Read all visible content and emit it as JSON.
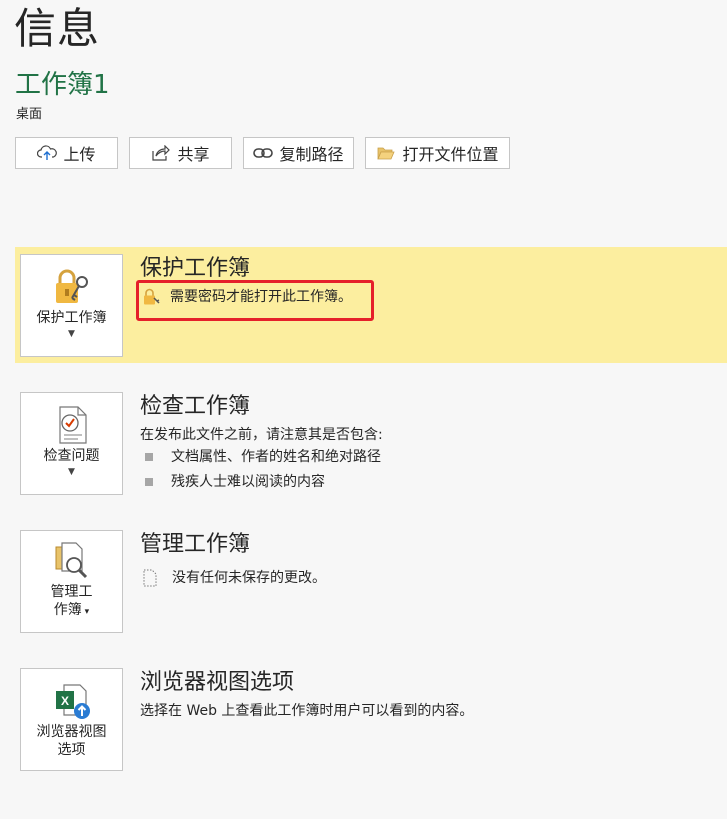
{
  "page": {
    "title": "信息"
  },
  "document": {
    "name": "工作簿1",
    "location": "桌面"
  },
  "actions": {
    "upload": "上传",
    "share": "共享",
    "copy_path": "复制路径",
    "open_location": "打开文件位置"
  },
  "protect": {
    "button_label": "保护工作簿",
    "title": "保护工作簿",
    "status": "需要密码才能打开此工作簿。"
  },
  "inspect": {
    "button_label": "检查问题",
    "title": "检查工作簿",
    "desc": "在发布此文件之前，请注意其是否包含:",
    "bullets": [
      "文档属性、作者的姓名和绝对路径",
      "残疾人士难以阅读的内容"
    ]
  },
  "manage": {
    "button_label_line1": "管理工",
    "button_label_line2": "作簿",
    "title": "管理工作簿",
    "status": "没有任何未保存的更改。"
  },
  "browser": {
    "button_label_line1": "浏览器视图",
    "button_label_line2": "选项",
    "title": "浏览器视图选项",
    "desc": "选择在 Web 上查看此工作簿时用户可以看到的内容。"
  },
  "colors": {
    "accent_green": "#217346",
    "highlight_yellow": "#fcee9f",
    "alert_red": "#e5202a"
  }
}
